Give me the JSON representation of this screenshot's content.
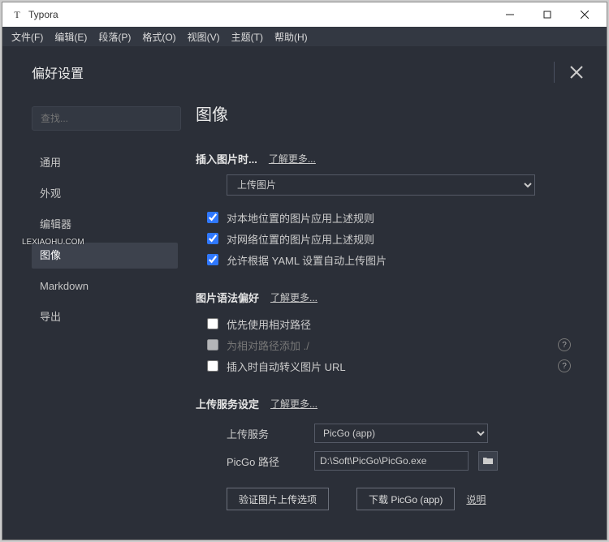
{
  "app": {
    "name": "Typora"
  },
  "menus": [
    "文件(F)",
    "编辑(E)",
    "段落(P)",
    "格式(O)",
    "视图(V)",
    "主题(T)",
    "帮助(H)"
  ],
  "prefs_title": "偏好设置",
  "search_placeholder": "查找...",
  "sidebar": {
    "items": [
      "通用",
      "外观",
      "编辑器",
      "图像",
      "Markdown",
      "导出"
    ],
    "active": "图像"
  },
  "watermark": "LEXIAOHU.COM",
  "content": {
    "heading": "图像",
    "insert": {
      "label": "插入图片时...",
      "learn_more": "了解更多...",
      "action_selected": "上传图片",
      "opts": [
        {
          "checked": true,
          "label": "对本地位置的图片应用上述规则"
        },
        {
          "checked": true,
          "label": "对网络位置的图片应用上述规则"
        },
        {
          "checked": true,
          "label": "允许根据 YAML 设置自动上传图片"
        }
      ]
    },
    "syntax": {
      "label": "图片语法偏好",
      "learn_more": "了解更多...",
      "opts": [
        {
          "checked": false,
          "label": "优先使用相对路径",
          "help": false,
          "disabled": false
        },
        {
          "checked": false,
          "label": "为相对路径添加 ./",
          "help": true,
          "disabled": true
        },
        {
          "checked": false,
          "label": "插入时自动转义图片 URL",
          "help": true,
          "disabled": false
        }
      ]
    },
    "upload": {
      "label": "上传服务设定",
      "learn_more": "了解更多...",
      "service_label": "上传服务",
      "service_value": "PicGo (app)",
      "path_label": "PicGo 路径",
      "path_value": "D:\\Soft\\PicGo\\PicGo.exe",
      "verify_btn": "验证图片上传选项",
      "download_btn": "下载 PicGo (app)",
      "instructions": "说明"
    }
  }
}
